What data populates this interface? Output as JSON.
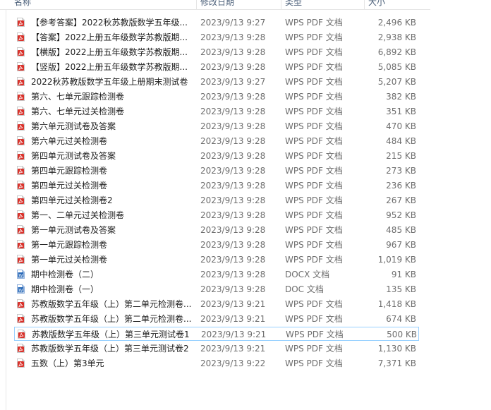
{
  "columns": {
    "name": "名称",
    "date": "修改日期",
    "type": "类型",
    "size": "大小"
  },
  "colors": {
    "pdf_icon": "#d9322b",
    "doc_icon": "#2a6ab8",
    "selection_border": "#99d1ff",
    "header_text": "#4c607a"
  },
  "files": [
    {
      "name": "【参考答案】2022秋苏教版数学五年级...",
      "date": "2023/9/13 9:27",
      "type": "WPS PDF 文档",
      "size": "2,496 KB",
      "icon": "pdf-icon"
    },
    {
      "name": "【答案】2022上册五年级数学苏教版期...",
      "date": "2023/9/13 9:28",
      "type": "WPS PDF 文档",
      "size": "2,938 KB",
      "icon": "pdf-icon"
    },
    {
      "name": "【横版】2022上册五年级数学苏教版期...",
      "date": "2023/9/13 9:28",
      "type": "WPS PDF 文档",
      "size": "6,892 KB",
      "icon": "pdf-icon"
    },
    {
      "name": "【竖版】2022上册五年级数学苏教版期...",
      "date": "2023/9/13 9:28",
      "type": "WPS PDF 文档",
      "size": "5,085 KB",
      "icon": "pdf-icon"
    },
    {
      "name": "2022秋苏教版数学五年级上册期末测试卷",
      "date": "2023/9/13 9:27",
      "type": "WPS PDF 文档",
      "size": "5,207 KB",
      "icon": "pdf-icon"
    },
    {
      "name": "第六、七单元跟踪检测卷",
      "date": "2023/9/13 9:28",
      "type": "WPS PDF 文档",
      "size": "382 KB",
      "icon": "pdf-icon"
    },
    {
      "name": "第六、七单元过关检测卷",
      "date": "2023/9/13 9:28",
      "type": "WPS PDF 文档",
      "size": "351 KB",
      "icon": "pdf-icon"
    },
    {
      "name": "第六单元测试卷及答案",
      "date": "2023/9/13 9:28",
      "type": "WPS PDF 文档",
      "size": "470 KB",
      "icon": "pdf-icon"
    },
    {
      "name": "第六单元过关检测卷",
      "date": "2023/9/13 9:28",
      "type": "WPS PDF 文档",
      "size": "484 KB",
      "icon": "pdf-icon"
    },
    {
      "name": "第四单元测试卷及答案",
      "date": "2023/9/13 9:28",
      "type": "WPS PDF 文档",
      "size": "215 KB",
      "icon": "pdf-icon"
    },
    {
      "name": "第四单元跟踪检测卷",
      "date": "2023/9/13 9:28",
      "type": "WPS PDF 文档",
      "size": "273 KB",
      "icon": "pdf-icon"
    },
    {
      "name": "第四单元过关检测卷",
      "date": "2023/9/13 9:28",
      "type": "WPS PDF 文档",
      "size": "236 KB",
      "icon": "pdf-icon"
    },
    {
      "name": "第四单元过关检测卷2",
      "date": "2023/9/13 9:28",
      "type": "WPS PDF 文档",
      "size": "267 KB",
      "icon": "pdf-icon"
    },
    {
      "name": "第一、二单元过关检测卷",
      "date": "2023/9/13 9:28",
      "type": "WPS PDF 文档",
      "size": "952 KB",
      "icon": "pdf-icon"
    },
    {
      "name": "第一单元测试卷及答案",
      "date": "2023/9/13 9:28",
      "type": "WPS PDF 文档",
      "size": "485 KB",
      "icon": "pdf-icon"
    },
    {
      "name": "第一单元跟踪检测卷",
      "date": "2023/9/13 9:28",
      "type": "WPS PDF 文档",
      "size": "967 KB",
      "icon": "pdf-icon"
    },
    {
      "name": "第一单元过关检测卷",
      "date": "2023/9/13 9:28",
      "type": "WPS PDF 文档",
      "size": "1,019 KB",
      "icon": "pdf-icon"
    },
    {
      "name": "期中检测卷（二）",
      "date": "2023/9/13 9:28",
      "type": "DOCX 文档",
      "size": "91 KB",
      "icon": "docx-icon"
    },
    {
      "name": "期中检测卷（一）",
      "date": "2023/9/13 9:28",
      "type": "DOC 文档",
      "size": "135 KB",
      "icon": "doc-icon"
    },
    {
      "name": "苏教版数学五年级（上）第二单元检测卷...",
      "date": "2023/9/13 9:21",
      "type": "WPS PDF 文档",
      "size": "1,418 KB",
      "icon": "pdf-icon"
    },
    {
      "name": "苏教版数学五年级（上）第二单元检测卷...",
      "date": "2023/9/13 9:21",
      "type": "WPS PDF 文档",
      "size": "674 KB",
      "icon": "pdf-icon"
    },
    {
      "name": "苏教版数学五年级（上）第三单元测试卷1",
      "date": "2023/9/13 9:21",
      "type": "WPS PDF 文档",
      "size": "500 KB",
      "icon": "pdf-icon",
      "selected": true
    },
    {
      "name": "苏教版数学五年级（上）第三单元测试卷2",
      "date": "2023/9/13 9:21",
      "type": "WPS PDF 文档",
      "size": "1,130 KB",
      "icon": "pdf-icon"
    },
    {
      "name": "五数（上）第3单元",
      "date": "2023/9/13 9:22",
      "type": "WPS PDF 文档",
      "size": "7,371 KB",
      "icon": "pdf-icon"
    }
  ]
}
